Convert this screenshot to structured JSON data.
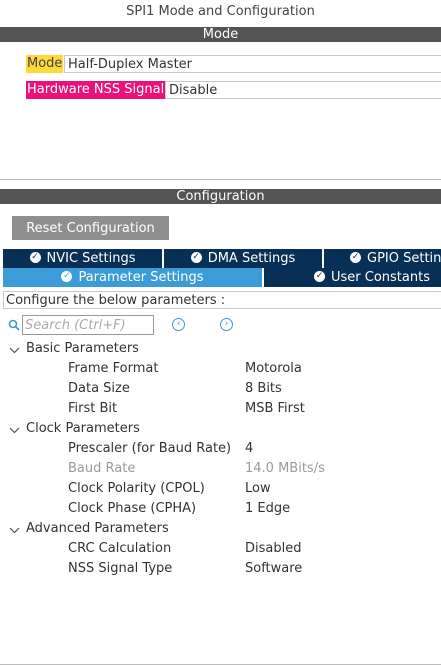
{
  "window_title": "SPI1 Mode and Configuration",
  "mode_section": {
    "header": "Mode",
    "mode_label": "Mode",
    "mode_value": "Half-Duplex Master",
    "nss_label": "Hardware NSS Signal",
    "nss_value": "Disable"
  },
  "config_section": {
    "header": "Configuration",
    "reset_label": "Reset Configuration",
    "tabs_row1": [
      {
        "label": "NVIC Settings"
      },
      {
        "label": "DMA Settings"
      },
      {
        "label": "GPIO Settin"
      }
    ],
    "tabs_row2": [
      {
        "label": "Parameter Settings",
        "active": true
      },
      {
        "label": "User Constants"
      }
    ],
    "description": "Configure the below parameters :",
    "search_placeholder": "Search (Ctrl+F)",
    "groups": [
      {
        "name": "Basic Parameters",
        "params": [
          {
            "name": "Frame Format",
            "value": "Motorola"
          },
          {
            "name": "Data Size",
            "value": "8 Bits"
          },
          {
            "name": "First Bit",
            "value": "MSB First"
          }
        ]
      },
      {
        "name": "Clock Parameters",
        "params": [
          {
            "name": "Prescaler (for Baud Rate)",
            "value": "4"
          },
          {
            "name": "Baud Rate",
            "value": "14.0 MBits/s",
            "disabled": true
          },
          {
            "name": "Clock Polarity (CPOL)",
            "value": "Low"
          },
          {
            "name": "Clock Phase (CPHA)",
            "value": "1 Edge"
          }
        ]
      },
      {
        "name": "Advanced Parameters",
        "params": [
          {
            "name": "CRC Calculation",
            "value": "Disabled"
          },
          {
            "name": "NSS Signal Type",
            "value": "Software"
          }
        ]
      }
    ]
  },
  "colors": {
    "section_bar": "#545454",
    "mode_label_bg": "#ffd83a",
    "nss_label_bg": "#e8127c",
    "tab_dark": "#083057",
    "tab_active": "#3b9cd8",
    "reset_button": "#8f8f8f"
  },
  "icons": {
    "tab_check": "check-circle-icon",
    "search": "search-icon",
    "prev": "previous-arrow-icon",
    "next": "next-arrow-icon",
    "group_toggle": "chevron-down-icon"
  }
}
